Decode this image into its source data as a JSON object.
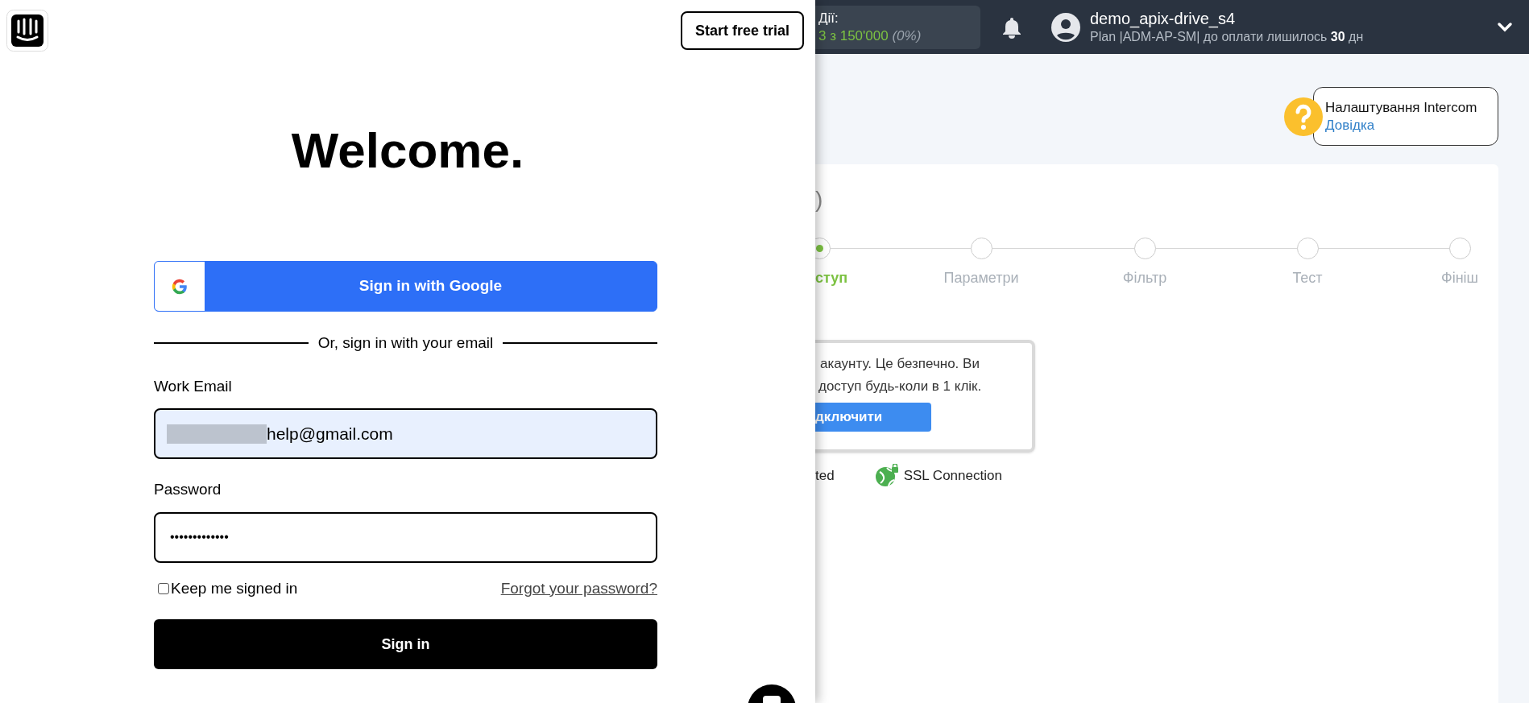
{
  "login": {
    "trial_button": "Start free trial",
    "heading": "Welcome.",
    "google_button": "Sign in with Google",
    "divider": "Or, sign in with your email",
    "email": {
      "label": "Work Email",
      "value": "help@gmail.com"
    },
    "password": {
      "label": "Password",
      "value": "•••••••••••••"
    },
    "keep_signed_in": {
      "label": "Keep me signed in",
      "checked": false
    },
    "forgot_link": "Forgot your password?",
    "sign_in_button": "Sign in"
  },
  "header": {
    "actions": {
      "label": "Дії:",
      "count": "3 з 150'000",
      "percent": "(0%)"
    },
    "user": {
      "name": "demo_apix-drive_s4",
      "plan": "Plan |ADM-AP-SM| до оплати лишилось **30** дн"
    }
  },
  "help": {
    "title": "Налаштування Intercom",
    "link": "Довідка"
  },
  "card": {
    "title_fragment": ")",
    "steps": [
      {
        "label": "ступ",
        "selected": true
      },
      {
        "label": "Параметри",
        "selected": false
      },
      {
        "label": "Фільтр",
        "selected": false
      },
      {
        "label": "Тест",
        "selected": false
      },
      {
        "label": "Фініш",
        "selected": false
      }
    ],
    "notice": {
      "lines": [
        "акаунту. Це безпечно. Ви",
        "доступ будь-коли в 1 клік."
      ],
      "button": "дключити"
    },
    "badges": [
      "ted",
      "SSL Connection"
    ]
  }
}
